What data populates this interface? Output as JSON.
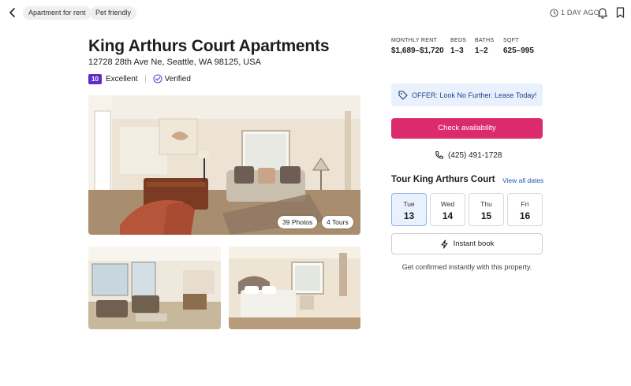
{
  "topbar": {
    "back_icon": "chevron-left-icon",
    "chips": [
      "Apartment for rent",
      "Pet friendly"
    ],
    "time_ago": "1 DAY AGO",
    "icons": [
      "clock-icon",
      "bell-icon",
      "bookmark-icon"
    ]
  },
  "listing": {
    "title": "King Arthurs Court Apartments",
    "address": "12728 28th Ave Ne, Seattle, WA 98125, USA",
    "rating_score": "10",
    "rating_label": "Excellent",
    "verified_label": "Verified"
  },
  "stats": [
    {
      "label": "MONTHLY RENT",
      "value": "$1,689–$1,720"
    },
    {
      "label": "BEDS",
      "value": "1–3"
    },
    {
      "label": "BATHS",
      "value": "1–2"
    },
    {
      "label": "SQFT",
      "value": "625–995"
    }
  ],
  "photos": {
    "photos_count_label": "39 Photos",
    "tours_count_label": "4 Tours"
  },
  "sidebar": {
    "offer_text": "OFFER: Look No Further. Lease Today!",
    "check_availability_label": "Check availability",
    "phone": "(425) 491-1728",
    "tour_title": "Tour King Arthurs Court",
    "view_all_label": "View all dates",
    "days": [
      {
        "name": "Tue",
        "date": "13",
        "selected": true
      },
      {
        "name": "Wed",
        "date": "14",
        "selected": false
      },
      {
        "name": "Thu",
        "date": "15",
        "selected": false
      },
      {
        "name": "Fri",
        "date": "16",
        "selected": false
      }
    ],
    "instant_book_label": "Instant book",
    "confirm_text": "Get confirmed instantly with this property."
  },
  "colors": {
    "accent_pink": "#dc2b6c",
    "score_purple": "#5b2ec9",
    "offer_bg": "#e9f2fc",
    "link_blue": "#1f55b8"
  }
}
